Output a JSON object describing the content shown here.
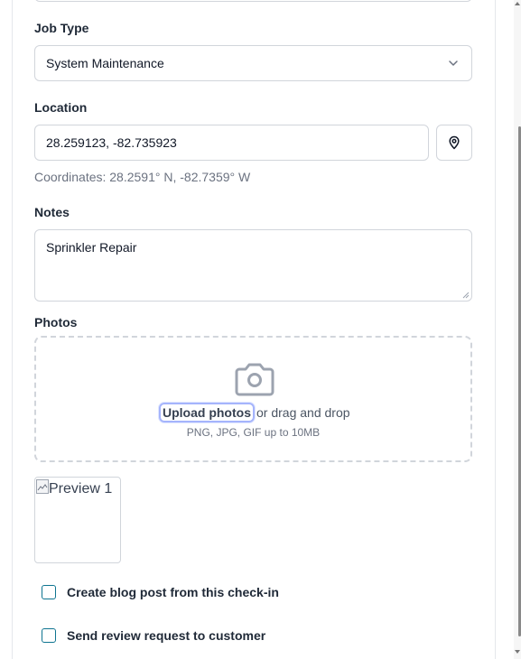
{
  "form": {
    "job_type": {
      "label": "Job Type",
      "value": "System Maintenance"
    },
    "location": {
      "label": "Location",
      "value": "28.259123, -82.735923",
      "coordinates_text": "Coordinates: 28.2591° N, -82.7359° W"
    },
    "notes": {
      "label": "Notes",
      "value": "Sprinkler Repair"
    },
    "photos": {
      "label": "Photos",
      "upload_link": "Upload photos",
      "upload_suffix": "or drag and drop",
      "hint": "PNG, JPG, GIF up to 10MB",
      "previews": [
        {
          "alt": "Preview 1"
        }
      ]
    },
    "options": [
      {
        "label": "Create blog post from this check-in",
        "checked": false
      },
      {
        "label": "Send review request to customer",
        "checked": false
      }
    ]
  },
  "icons": {
    "select_chevron": "chevron-down-icon",
    "location_button": "map-pin-icon",
    "upload": "camera-icon",
    "broken_image": "broken-image-icon"
  },
  "colors": {
    "border": "#d1d5db",
    "label": "#1f2937",
    "muted": "#6b7280",
    "checkbox_border": "#0e7490",
    "focus_ring": "#a5b4fc"
  }
}
